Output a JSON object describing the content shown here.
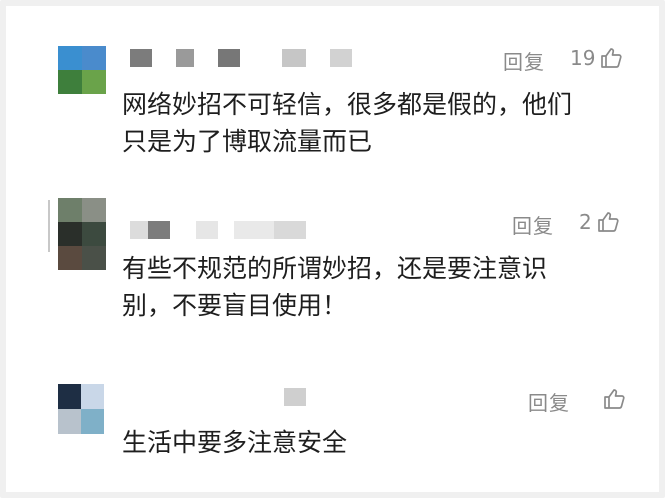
{
  "comments": [
    {
      "reply_label": "回复",
      "like_count": "19",
      "text_lines": [
        "网络妙招不可轻信，很多都是假的，他们",
        "只是为了博取流量而已"
      ],
      "avatar_colors": [
        "#3a8fd0",
        "#4a8bcc",
        "#3e7f3c",
        "#6aa34a"
      ]
    },
    {
      "reply_label": "回复",
      "like_count": "2",
      "text_lines": [
        "有些不规范的所谓妙招，还是要注意识",
        "别，不要盲目使用！"
      ],
      "avatar_colors": [
        "#6e7f6a",
        "#8a8f86",
        "#2a2f2a",
        "#3c4a3f",
        "#5a4a3f",
        "#4a5048"
      ]
    },
    {
      "reply_label": "回复",
      "like_count": "",
      "text_lines": [
        "生活中要多注意安全"
      ],
      "avatar_colors": [
        "#1e2e44",
        "#c9d7e8",
        "#b8c2cc",
        "#7fb0c8"
      ]
    }
  ],
  "colors": {
    "text": "#1e1e1e",
    "meta": "#8a8a8a",
    "frame": "#f0f0f0"
  }
}
